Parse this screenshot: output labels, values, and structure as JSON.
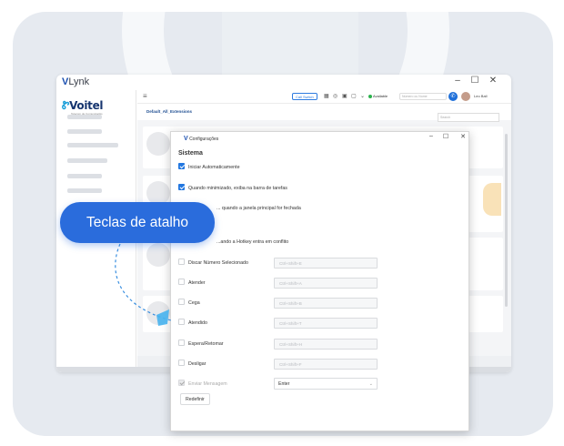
{
  "app": {
    "title_mark": "V",
    "title": "Lynk",
    "window_controls": {
      "minimize": "–",
      "maximize": "☐",
      "close": "✕"
    }
  },
  "sidebar": {
    "logo_mark": "Ꮡ",
    "logo_text": "Voitel",
    "logo_sub": "Telecom de Comunicação"
  },
  "topbar": {
    "menu_icon": "≡",
    "call_switch_label": "Call Switch",
    "status_label": "Available",
    "number_placeholder": "Número ou Nome",
    "user_name": "Leo Ball"
  },
  "extensions": {
    "title": "Default_All_Extensions",
    "search_placeholder": "Search"
  },
  "dialog": {
    "title_mark": "V",
    "title": "Configurações",
    "controls": {
      "minimize": "–",
      "maximize": "☐",
      "close": "✕"
    },
    "section_title": "Sistema",
    "options": [
      {
        "label": "Iniciar Automaticamente",
        "checked": true
      },
      {
        "label": "Quando minimizado, exiba na barra de tarefas",
        "checked": true
      },
      {
        "label": "... quando a janela principal for fechada",
        "checked": false
      }
    ],
    "conflict_label": "...ando a Hotkey entra em conflito",
    "hotkeys": [
      {
        "label": "Discar Número Selecionado",
        "placeholder": "Ctrl+Shift+E"
      },
      {
        "label": "Atender",
        "placeholder": "Ctrl+Shift+A"
      },
      {
        "label": "Cega",
        "placeholder": "Ctrl+Shift+B"
      },
      {
        "label": "Atendido",
        "placeholder": "Ctrl+Shift+T"
      },
      {
        "label": "Espera/Retomar",
        "placeholder": "Ctrl+Shift+H"
      },
      {
        "label": "Desligar",
        "placeholder": "Ctrl+Shift+F"
      }
    ],
    "send_message": {
      "label": "Enviar Mensagem",
      "value": "Enter"
    },
    "reset_label": "Redefinir"
  },
  "callout": {
    "label": "Teclas de atalho"
  },
  "colors": {
    "accent": "#2a6cdc",
    "checkbox": "#2277e0",
    "brand_dark": "#15346e",
    "brand_light": "#1ea0d9",
    "background_card": "#e6eaf0"
  }
}
